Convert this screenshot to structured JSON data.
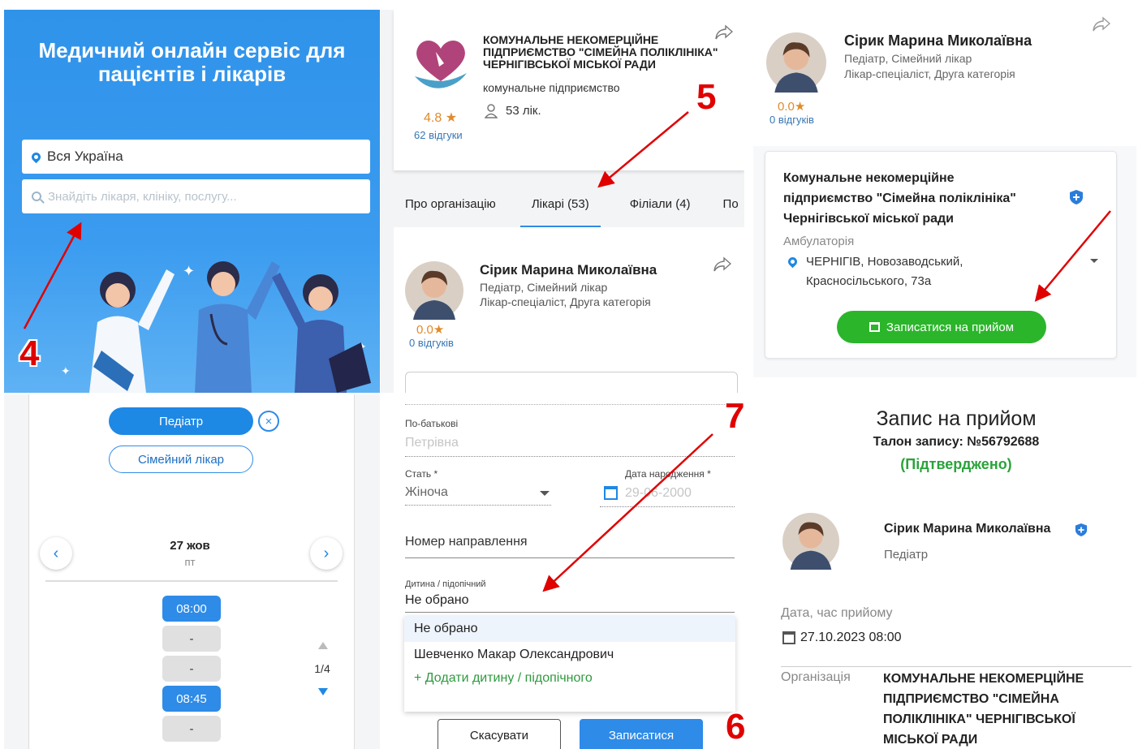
{
  "annotations": [
    "4",
    "5",
    "6",
    "7"
  ],
  "hero": {
    "title_line1": "Медичний онлайн сервіс для",
    "title_line2": "пацієнтів і лікарів",
    "location_value": "Вся Україна",
    "search_placeholder": "Знайдіть лікаря, клініку, послугу..."
  },
  "organization": {
    "name_line1": "КОМУНАЛЬНЕ НЕКОМЕРЦІЙНЕ",
    "name_line2": "ПІДПРИЄМСТВО \"СІМЕЙНА ПОЛІКЛІНІКА\"",
    "name_line3": "ЧЕРНІГІВСЬКОЇ МІСЬКОЇ РАДИ",
    "type": "комунальне підприємство",
    "doctors_count": "53 лік.",
    "rating": "4.8 ★",
    "reviews": "62 відгуки",
    "tabs": [
      {
        "label": "Про організацію"
      },
      {
        "label": "Лікарі (53)"
      },
      {
        "label": "Філіали (4)"
      },
      {
        "label": "По"
      }
    ]
  },
  "doctor": {
    "name": "Сірик Марина Миколаївна",
    "spec_line1": "Педіатр, Сімейний лікар",
    "spec_line2": "Лікар-спеціаліст, Друга категорія",
    "rating": "0.0★",
    "reviews": "0 відгуків"
  },
  "clinic": {
    "name_line1": "Комунальне некомерційне",
    "name_line2": "підприємство \"Сімейна поліклініка\"",
    "name_line3": "Чернігівської міської ради",
    "kind": "Амбулаторія",
    "address_line1": "ЧЕРНІГІВ, Новозаводський,",
    "address_line2": "Красносільського, 73а",
    "book_button": "Записатися на прийом"
  },
  "schedule": {
    "specialty_selected": "Педіатр",
    "specialty_other": "Сімейний лікар",
    "clear_icon": "×",
    "prev_icon": "‹",
    "next_icon": "›",
    "date": "27 жов",
    "weekday": "пт",
    "slots": [
      "08:00",
      "-",
      "-",
      "08:45",
      "-"
    ],
    "page": "1/4"
  },
  "form": {
    "patronymic_label": "По-батькові",
    "patronymic_placeholder": "Петрівна",
    "gender_label": "Стать *",
    "gender_value": "Жіноча",
    "birth_label": "Дата народження *",
    "birth_placeholder": "29-06-2000",
    "referral_label": "Номер направлення",
    "child_label": "Дитина / підопічний",
    "child_value": "Не обрано",
    "options": [
      "Не обрано",
      "Шевченко Макар Олександрович"
    ],
    "add_child": "+ Додати дитину / підопічного",
    "cancel_button": "Скасувати",
    "submit_button": "Записатися"
  },
  "confirmation": {
    "title": "Запис на прийом",
    "ticket": "Талон запису: №56792688",
    "status": "(Підтверджено)",
    "doctor_name": "Сірик Марина Миколаївна",
    "doctor_spec": "Педіатр",
    "datetime_label": "Дата, час прийому",
    "datetime_value": "27.10.2023 08:00",
    "org_label": "Організація",
    "org_line1": "КОМУНАЛЬНЕ НЕКОМЕРЦІЙНЕ",
    "org_line2": "ПІДПРИЄМСТВО \"СІМЕЙНА",
    "org_line3": "ПОЛІКЛІНІКА\" ЧЕРНІГІВСЬКОЇ",
    "org_line4": "МІСЬКОЇ РАДИ"
  },
  "colors": {
    "primary_blue": "#2e8be7",
    "hero_blue": "#3a9bef",
    "book_green": "#2bb52b",
    "confirmed_green": "#2aa33a",
    "rating_orange": "#e08a2a",
    "annotation_red": "#e00000"
  }
}
